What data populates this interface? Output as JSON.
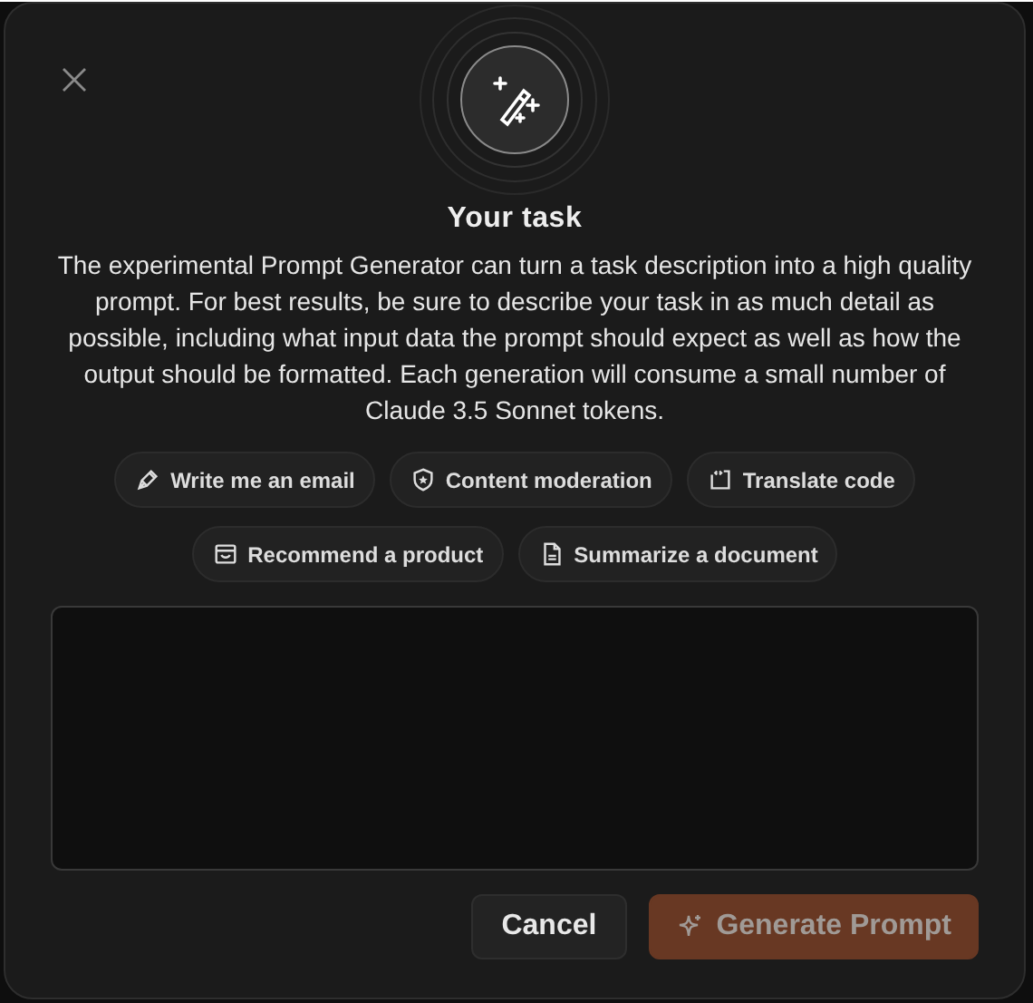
{
  "dialog": {
    "title": "Your task",
    "description": "The experimental Prompt Generator can turn a task description into a high quality prompt. For best results, be sure to describe your task in as much detail as possible, including what input data the prompt should expect as well as how the output should be formatted. Each generation will consume a small number of Claude 3.5 Sonnet tokens."
  },
  "suggestions": [
    {
      "label": "Write me an email",
      "kind": "pen"
    },
    {
      "label": "Content moderation",
      "kind": "shield"
    },
    {
      "label": "Translate code",
      "kind": "code"
    },
    {
      "label": "Recommend a product",
      "kind": "inbox"
    },
    {
      "label": "Summarize a document",
      "kind": "document"
    }
  ],
  "buttons": [
    {
      "label": "Cancel",
      "kind": "secondary",
      "disabled": false
    },
    {
      "label": "Generate Prompt",
      "kind": "primary",
      "disabled": true
    }
  ]
}
